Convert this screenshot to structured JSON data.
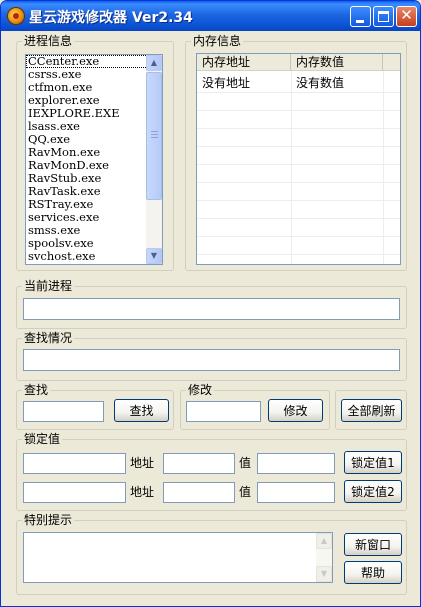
{
  "window": {
    "title": "星云游戏修改器 Ver2.34",
    "controls": {
      "minimize": "minimize-icon",
      "maximize": "maximize-icon",
      "close": "close-icon"
    }
  },
  "process_group": {
    "label": "进程信息",
    "items": [
      "CCenter.exe",
      "csrss.exe",
      "ctfmon.exe",
      "explorer.exe",
      "IEXPLORE.EXE",
      "lsass.exe",
      "QQ.exe",
      "RavMon.exe",
      "RavMonD.exe",
      "RavStub.exe",
      "RavTask.exe",
      "RSTray.exe",
      "services.exe",
      "smss.exe",
      "spoolsv.exe",
      "svchost.exe"
    ],
    "selected_index": 0
  },
  "memory_group": {
    "label": "内存信息",
    "columns": [
      "内存地址",
      "内存数值"
    ],
    "rows": [
      [
        "没有地址",
        "没有数值"
      ]
    ]
  },
  "current_process": {
    "label": "当前进程",
    "value": ""
  },
  "search_status": {
    "label": "查找情况",
    "value": ""
  },
  "search": {
    "label": "查找",
    "value": "",
    "button": "查找"
  },
  "modify": {
    "label": "修改",
    "value": "",
    "button": "修改"
  },
  "refresh_all_button": "全部刷新",
  "lock_group": {
    "label": "锁定值",
    "rows": [
      {
        "name": "",
        "address_label": "地址",
        "address": "",
        "value_label": "值",
        "value": "",
        "button": "锁定值1"
      },
      {
        "name": "",
        "address_label": "地址",
        "address": "",
        "value_label": "值",
        "value": "",
        "button": "锁定值2"
      }
    ]
  },
  "tips_group": {
    "label": "特别提示",
    "text": "",
    "new_window_button": "新窗口",
    "help_button": "帮助"
  },
  "colors": {
    "titlebar": "#0b54d6",
    "face": "#ece9d8",
    "border": "#7f9db9"
  }
}
